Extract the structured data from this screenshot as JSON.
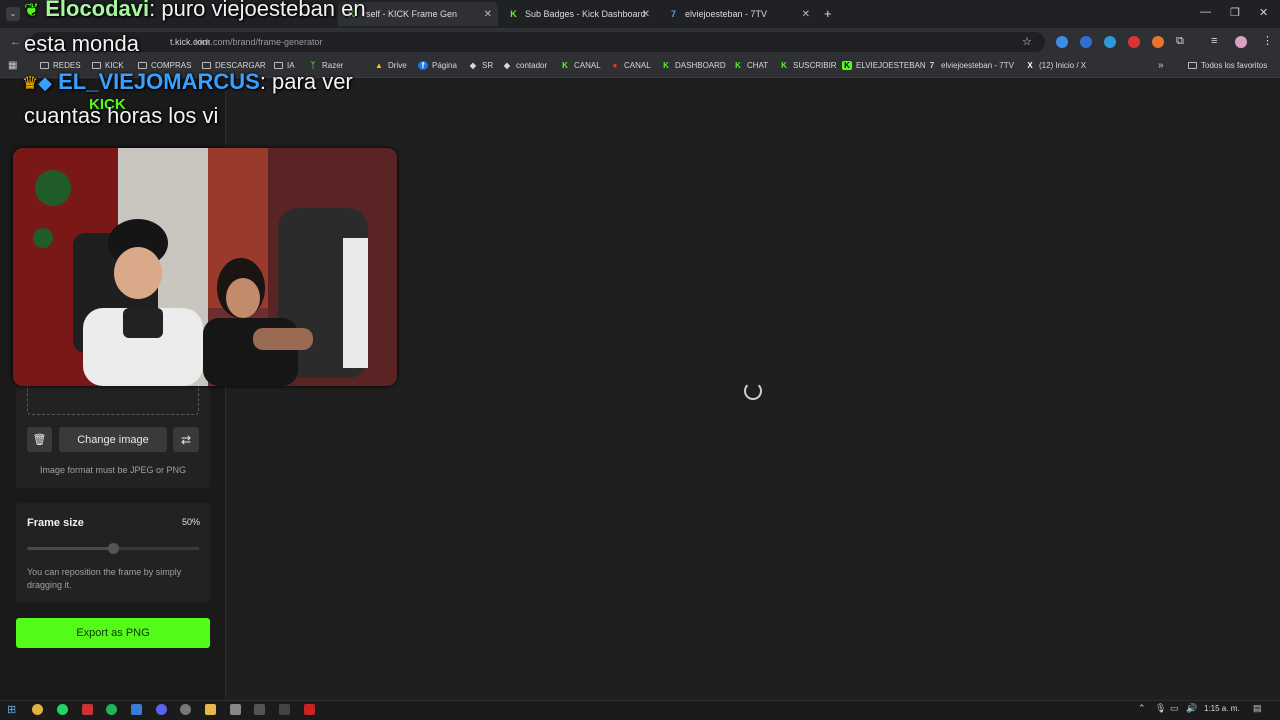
{
  "browser": {
    "tabs": [
      {
        "label": "rself - KICK Frame Gen",
        "active": true
      },
      {
        "label": "Sub Badges - Kick Dashboard",
        "active": false
      },
      {
        "label": "elviejoesteban - 7TV",
        "active": false
      }
    ],
    "address": "kick.com/brand/frame-generator",
    "address_prefix": "t.kick.com",
    "new_tab": "+"
  },
  "bookmarks": [
    {
      "label": "REDES",
      "icon": "folder-icon"
    },
    {
      "label": "KICK",
      "icon": "folder-icon"
    },
    {
      "label": "COMPRAS",
      "icon": "folder-icon"
    },
    {
      "label": "DESCARGAR",
      "icon": "folder-icon"
    },
    {
      "label": "IA",
      "icon": "folder-icon"
    },
    {
      "label": "Razer",
      "icon": "razer-icon"
    },
    {
      "label": "Drive",
      "icon": "drive-icon"
    },
    {
      "label": "Página",
      "icon": "facebook-icon"
    },
    {
      "label": "SR",
      "icon": "diamond-icon"
    },
    {
      "label": "contador",
      "icon": "diamond-icon"
    },
    {
      "label": "CANAL",
      "icon": "kick-icon"
    },
    {
      "label": "CANAL",
      "icon": "youtube-icon"
    },
    {
      "label": "DASHBOARD",
      "icon": "kick-icon"
    },
    {
      "label": "CHAT",
      "icon": "kick-icon"
    },
    {
      "label": "SUSCRIBIR",
      "icon": "kick-icon"
    },
    {
      "label": "ELVIEJOESTEBAN",
      "icon": "kick-icon"
    },
    {
      "label": "elviejoesteban - 7TV",
      "icon": "7tv-icon"
    },
    {
      "label": "(12) Inicio / X",
      "icon": "x-icon"
    }
  ],
  "favorites_label": "Todos los favoritos",
  "overlay_chat": {
    "line1_user": "Elocodavi",
    "line1_text": ": puro viejoesteban en",
    "line2_text": "esta monda",
    "line3_user": "EL_VIEJOMARCUS",
    "line3_text": ": para ver",
    "line4_text": "cuantas horas los vi",
    "badge_text": "KICK"
  },
  "sidebar": {
    "change_image": "Change image",
    "format_note": "Image format must be JPEG or PNG",
    "frame_size_label": "Frame size",
    "frame_size_value": "50%",
    "frame_size_fraction": 0.5,
    "reposition_note": "You can reposition the frame by simply dragging it.",
    "export_label": "Export as PNG"
  },
  "taskbar": {
    "time": "1:15 a. m."
  },
  "colors": {
    "kick_green": "#53fc18",
    "page_bg": "#1f1f1f",
    "sidebar_bg": "#1a1a1a"
  }
}
